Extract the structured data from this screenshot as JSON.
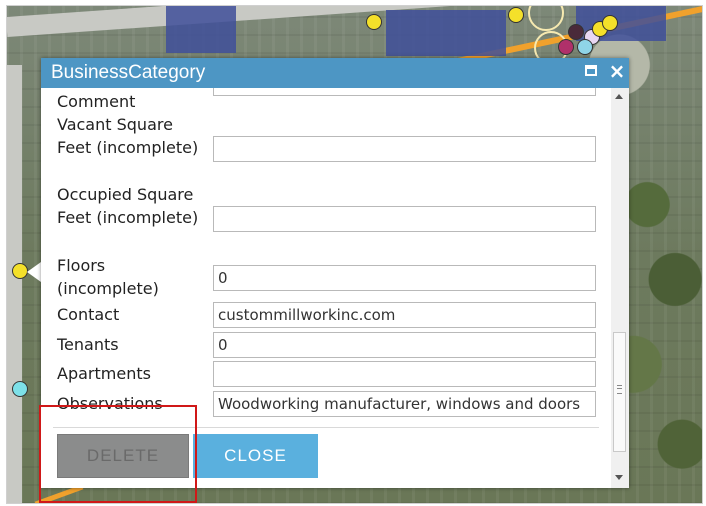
{
  "dialog": {
    "title": "BusinessCategory",
    "icons": {
      "maximize": "maximize-icon",
      "close": "close-icon"
    }
  },
  "form": {
    "comment": {
      "label": "Comment",
      "value": ""
    },
    "vacant_square_feet": {
      "label": "Vacant Square Feet (incomplete)",
      "value": ""
    },
    "occupied_square_feet": {
      "label": "Occupied Square Feet (incomplete)",
      "value": ""
    },
    "floors": {
      "label": "Floors (incomplete)",
      "value": "0"
    },
    "contact": {
      "label": "Contact",
      "value": "custommillworkinc.com"
    },
    "tenants": {
      "label": "Tenants",
      "value": "0"
    },
    "apartments": {
      "label": "Apartments",
      "value": ""
    },
    "observations": {
      "label": "Observations",
      "value": "Woodworking manufacturer, windows and doors"
    }
  },
  "buttons": {
    "delete": "DELETE",
    "close": "CLOSE"
  },
  "colors": {
    "titlebar": "#4d96c4",
    "close_button": "#5ab0de",
    "delete_button": "#8b8c8c",
    "highlight": "#d01818"
  }
}
